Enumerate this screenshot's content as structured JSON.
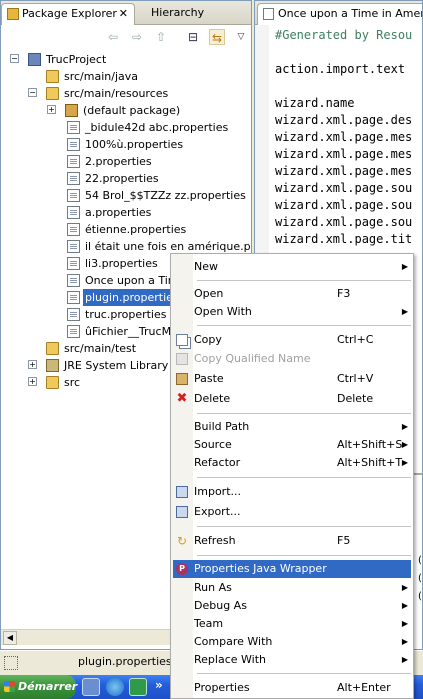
{
  "explorer": {
    "tab_label": "Package Explorer",
    "tab_close": "✕",
    "hierarchy_tab": "Hierarchy",
    "toolbar": {
      "back": "⇦",
      "forward": "⇨",
      "up": "⇧",
      "collapse": "⊟",
      "link": "⇆",
      "menu": "▽"
    },
    "tree": [
      "TrucProject",
      "src/main/java",
      "src/main/resources",
      "(default package)",
      "_bidule42d abc.properties",
      "100%ù.properties",
      "2.properties",
      "22.properties",
      "54 Brol_$$TZZz zz.properties",
      "a.properties",
      "étienne.properties",
      "il était une fois en amérique.prope",
      "li3.properties",
      "Once upon a Time",
      "plugin.properties",
      "truc.properties",
      "ûFichier__TrucMuc",
      "src/main/test",
      "JRE System Library [jr",
      "src"
    ]
  },
  "editor": {
    "tab_label": "Once upon a Time in America.p",
    "lines": [
      "#Generated by Resou",
      "",
      "action.import.text",
      "",
      "wizard.name",
      "wizard.xml.page.des",
      "wizard.xml.page.mes",
      "wizard.xml.page.mes",
      "wizard.xml.page.mes",
      "wizard.xml.page.sou",
      "wizard.xml.page.sou",
      "wizard.xml.page.sou",
      "wizard.xml.page.tit"
    ],
    "lower_panel": [
      "(S",
      "(S",
      "(S"
    ]
  },
  "context_menu": {
    "items": [
      {
        "label": "New",
        "shortcut": "",
        "submenu": true
      },
      {
        "label": "Open",
        "shortcut": "F3",
        "submenu": false
      },
      {
        "label": "Open With",
        "shortcut": "",
        "submenu": true
      },
      {
        "label": "Copy",
        "shortcut": "Ctrl+C",
        "submenu": false
      },
      {
        "label": "Copy Qualified Name",
        "shortcut": "",
        "submenu": false,
        "disabled": true
      },
      {
        "label": "Paste",
        "shortcut": "Ctrl+V",
        "submenu": false
      },
      {
        "label": "Delete",
        "shortcut": "Delete",
        "submenu": false
      },
      {
        "label": "Build Path",
        "shortcut": "",
        "submenu": true
      },
      {
        "label": "Source",
        "shortcut": "Alt+Shift+S",
        "submenu": true
      },
      {
        "label": "Refactor",
        "shortcut": "Alt+Shift+T",
        "submenu": true
      },
      {
        "label": "Import...",
        "shortcut": "",
        "submenu": false
      },
      {
        "label": "Export...",
        "shortcut": "",
        "submenu": false
      },
      {
        "label": "Refresh",
        "shortcut": "F5",
        "submenu": false
      },
      {
        "label": "Properties Java Wrapper",
        "shortcut": "",
        "submenu": false,
        "highlighted": true
      },
      {
        "label": "Run As",
        "shortcut": "",
        "submenu": true
      },
      {
        "label": "Debug As",
        "shortcut": "",
        "submenu": true
      },
      {
        "label": "Team",
        "shortcut": "",
        "submenu": true
      },
      {
        "label": "Compare With",
        "shortcut": "",
        "submenu": true
      },
      {
        "label": "Replace With",
        "shortcut": "",
        "submenu": true
      },
      {
        "label": "Properties",
        "shortcut": "Alt+Enter",
        "submenu": false
      }
    ]
  },
  "statusbar": {
    "text": "plugin.properties -"
  },
  "taskbar": {
    "start_label": "Démarrer",
    "chevron": "»"
  },
  "colors": {
    "selection": "#316ac5",
    "comment": "#3f7f5f"
  }
}
